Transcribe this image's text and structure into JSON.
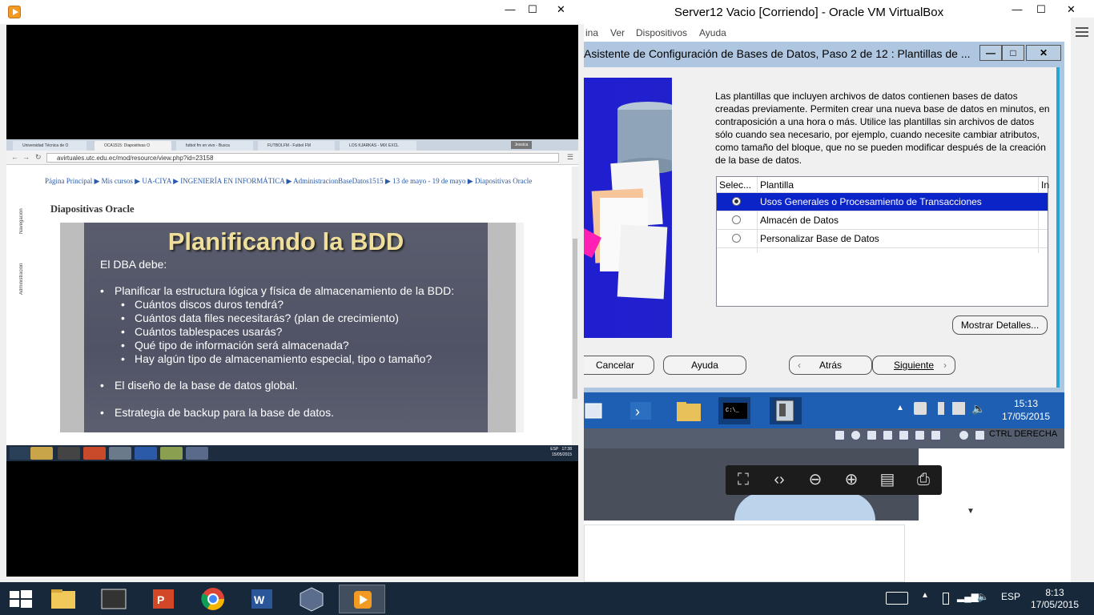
{
  "player": {
    "minimize": "—",
    "maximize": "☐",
    "close": "✕"
  },
  "browser": {
    "tabs": [
      "Universidad Técnica de O",
      "OCA1515: Diapositivas O",
      "futbol fm en vivo - Busca",
      "FUTBOLFM - Futbol FM",
      "LOS KJARKAS - MIX EXCL"
    ],
    "user_badge": "Jessica",
    "url": "avirtuales.utc.edu.ec/mod/resource/view.php?id=23158",
    "sidebar_tabs": [
      "Navegación",
      "Administración"
    ],
    "breadcrumb": "Página Principal ▶ Mis cursos ▶ UA-CIYA ▶ INGENIERÍA EN INFORMÁTICA ▶ AdministracionBaseDatos1515 ▶ 13 de mayo - 19 de mayo ▶ Diapositivas Oracle",
    "resource_title": "Diapositivas Oracle",
    "inner_clock_time": "17:38",
    "inner_clock_date": "15/05/2015",
    "inner_lang": "ESP"
  },
  "slide": {
    "title": "Planificando la BDD",
    "intro": "El DBA debe:",
    "bullet1": "Planificar la estructura lógica y física de almacenamiento de la BDD:",
    "sub1": "Cuántos discos duros tendrá?",
    "sub2": "Cuántos data files necesitarás? (plan de crecimiento)",
    "sub3": "Cuántos tablespaces usarás?",
    "sub4": "Qué tipo de información será almacenada?",
    "sub5": "Hay algún tipo de almacenamiento especial, tipo o tamaño?",
    "bullet2": "El diseño de la base de datos global.",
    "bullet3": "Estrategia de backup para la base de datos."
  },
  "vbox": {
    "title": "Server12 Vacio [Corriendo] - Oracle VM VirtualBox",
    "menu": [
      "ina",
      "Ver",
      "Dispositivos",
      "Ayuda"
    ],
    "status_hostkey": "CTRL DERECHA"
  },
  "dbca": {
    "title": "Asistente de Configuración de Bases de Datos, Paso 2 de 12 : Plantillas de ...",
    "description": "Las plantillas que incluyen archivos de datos contienen bases de datos creadas previamente. Permiten crear una nueva base de datos en minutos, en contraposición a una hora o más. Utilice las plantillas sin archivos de datos sólo cuando sea necesario, por ejemplo, cuando necesite cambiar atributos, como tamaño del bloque, que no se pueden modificar después de la creación de la base de datos.",
    "columns": [
      "Selec...",
      "Plantilla",
      "In"
    ],
    "templates": [
      {
        "label": "Usos Generales o Procesamiento de Transacciones",
        "selected": true
      },
      {
        "label": "Almacén de Datos",
        "selected": false
      },
      {
        "label": "Personalizar Base de Datos",
        "selected": false
      }
    ],
    "details_button": "Mostrar Detalles...",
    "cancel_button": "Cancelar",
    "help_button": "Ayuda",
    "back_button": "Atrás",
    "next_button": "Siguiente",
    "min": "—",
    "max": "□",
    "close": "✕"
  },
  "vm_taskbar": {
    "time": "15:13",
    "date": "17/05/2015"
  },
  "host_taskbar": {
    "lang": "ESP",
    "time": "8:13",
    "date": "17/05/2015"
  },
  "colors": {
    "selection": "#0a24c8",
    "vm_taskbar": "#1e5fb3",
    "host_taskbar": "#16283a",
    "slide_title": "#f0df9c"
  }
}
